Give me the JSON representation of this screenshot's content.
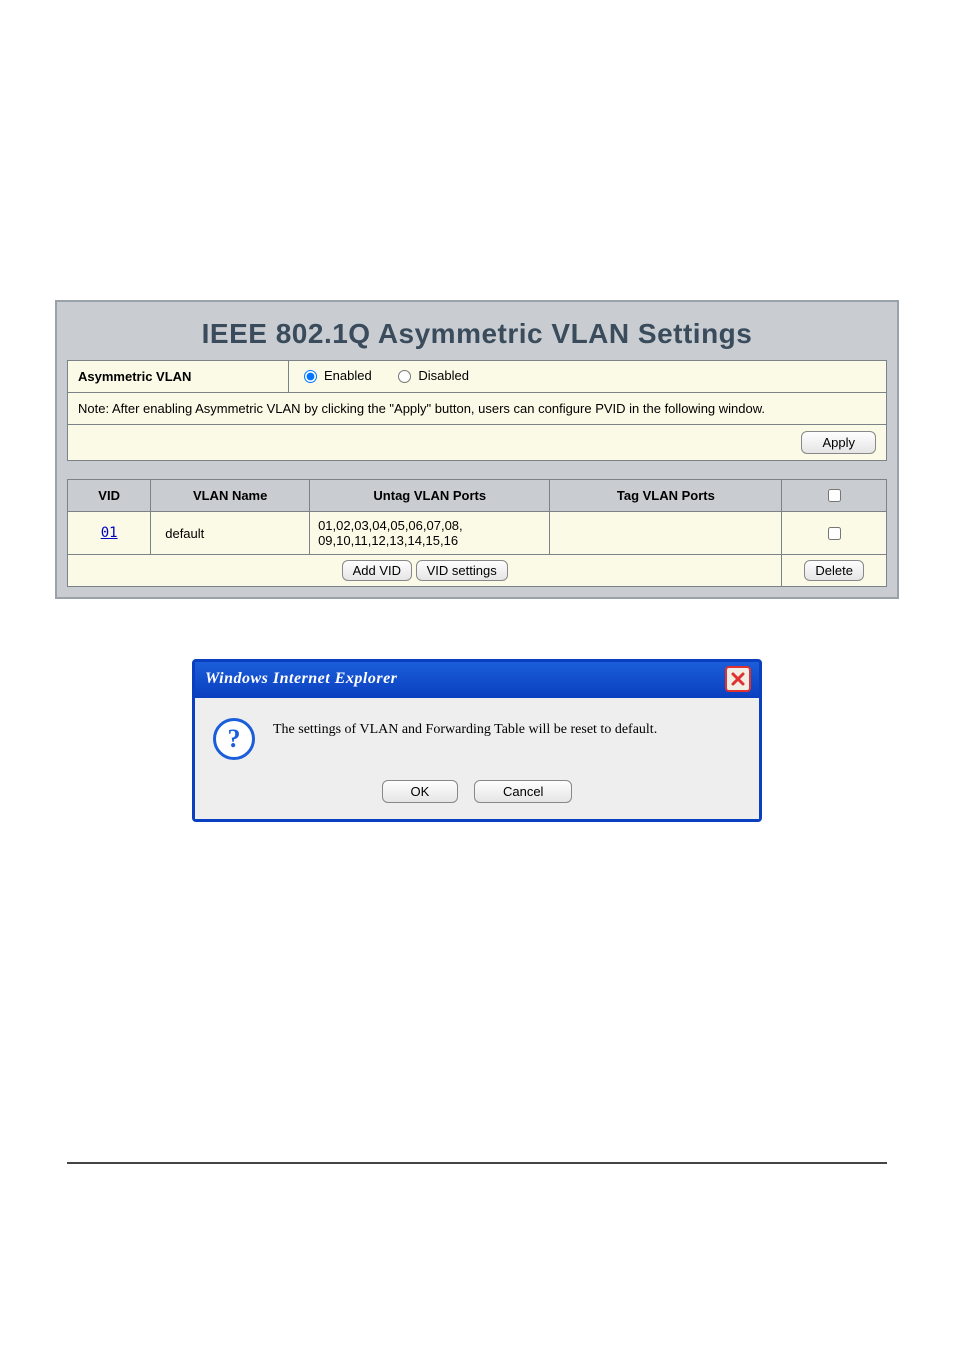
{
  "page": {
    "title": "IEEE 802.1Q Asymmetric VLAN Settings"
  },
  "asymmetric": {
    "label": "Asymmetric VLAN",
    "enabled_label": "Enabled",
    "disabled_label": "Disabled",
    "selected": "enabled",
    "note": "Note: After enabling Asymmetric VLAN by clicking the \"Apply\" button, users can configure PVID in the following window.",
    "apply_label": "Apply"
  },
  "table": {
    "headers": {
      "vid": "VID",
      "name": "VLAN Name",
      "untag": "Untag VLAN Ports",
      "tag": "Tag VLAN Ports"
    },
    "rows": [
      {
        "vid": "01",
        "name": "default",
        "untag": "01,02,03,04,05,06,07,08,\n09,10,11,12,13,14,15,16",
        "tag": "",
        "checked": false
      }
    ],
    "actions": {
      "add_vid": "Add VID",
      "vid_settings": "VID settings",
      "delete": "Delete"
    }
  },
  "dialog": {
    "title": "Windows Internet Explorer",
    "message": "The settings of VLAN and Forwarding Table will be reset to default.",
    "ok": "OK",
    "cancel": "Cancel"
  }
}
